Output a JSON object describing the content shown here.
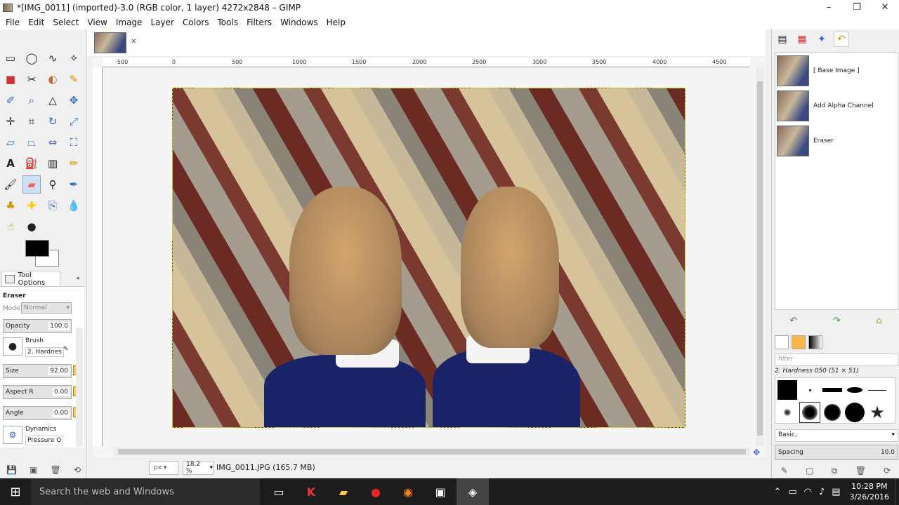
{
  "window": {
    "title": "*[IMG_0011] (imported)-3.0 (RGB color, 1 layer) 4272x2848 – GIMP"
  },
  "menu": [
    "File",
    "Edit",
    "Select",
    "View",
    "Image",
    "Layer",
    "Colors",
    "Tools",
    "Filters",
    "Windows",
    "Help"
  ],
  "tool_options": {
    "tab_label": "Tool Options",
    "tool_name": "Eraser",
    "mode_label": "Mode:",
    "mode_value": "Normal",
    "opacity_label": "Opacity",
    "opacity_value": "100.0",
    "brush_label": "Brush",
    "brush_value": "2. Hardnes",
    "size_label": "Size",
    "size_value": "92.00",
    "aspect_label": "Aspect R",
    "aspect_value": "0.00",
    "angle_label": "Angle",
    "angle_value": "0.00",
    "dynamics_label": "Dynamics",
    "dynamics_value": "Pressure O"
  },
  "ruler": {
    "ticks": [
      "-500",
      "0",
      "500",
      "1000",
      "1500",
      "2000",
      "2500",
      "3000",
      "3500",
      "4000",
      "4500"
    ]
  },
  "status": {
    "unit": "px",
    "zoom": "18.2 %",
    "text": "IMG_0011.JPG (165.7 MB)"
  },
  "history": {
    "items": [
      {
        "label": "[ Base Image ]"
      },
      {
        "label": "Add Alpha Channel"
      },
      {
        "label": "Eraser"
      }
    ]
  },
  "brushes": {
    "filter_placeholder": "filter",
    "selected_name": "2. Hardness 050 (51 × 51)",
    "preset": "Basic,",
    "spacing_label": "Spacing",
    "spacing_value": "10.0"
  },
  "taskbar": {
    "search_placeholder": "Search the web and Windows",
    "time": "10:28 PM",
    "date": "3/26/2016"
  }
}
